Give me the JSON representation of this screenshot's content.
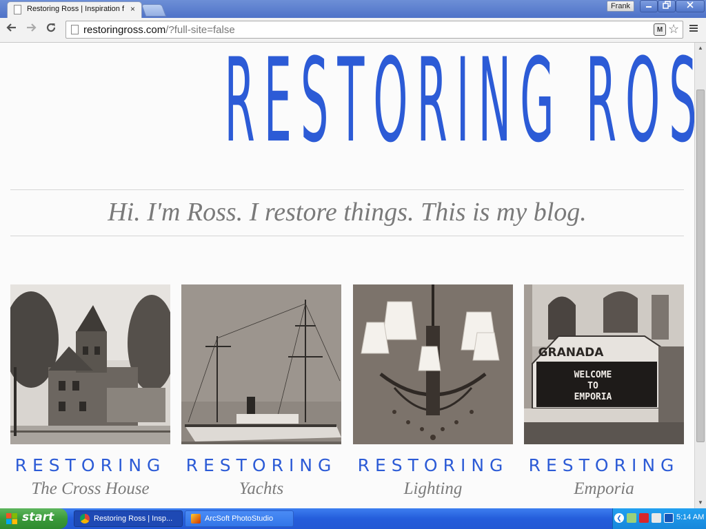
{
  "browser": {
    "tab_title": "Restoring Ross | Inspiration f",
    "tab_close": "×",
    "profile_name": "Frank",
    "url_host": "restoringross.com",
    "url_path": "/?full-site=false",
    "extension_badge": "M"
  },
  "page": {
    "site_title": "RESTORING ROSS",
    "tagline": "Hi. I'm Ross. I restore things. This is my blog.",
    "cards": [
      {
        "label": "RESTORING",
        "sub": "The Cross House"
      },
      {
        "label": "RESTORING",
        "sub": "Yachts"
      },
      {
        "label": "RESTORING",
        "sub": "Lighting"
      },
      {
        "label": "RESTORING",
        "sub": "Emporia"
      }
    ],
    "marquee": {
      "name": "GRANADA",
      "line1": "WELCOME",
      "line2": "TO",
      "line3": "EMPORIA"
    }
  },
  "taskbar": {
    "start_label": "start",
    "tasks": [
      {
        "label": "Restoring Ross | Insp..."
      },
      {
        "label": "ArcSoft PhotoStudio"
      }
    ],
    "clock": "5:14 AM"
  },
  "colors": {
    "title_blue": "#2c5bd6",
    "tagline_gray": "#7a7a7a",
    "taskbar_blue": "#245ddb",
    "start_green": "#3a9a3a"
  }
}
